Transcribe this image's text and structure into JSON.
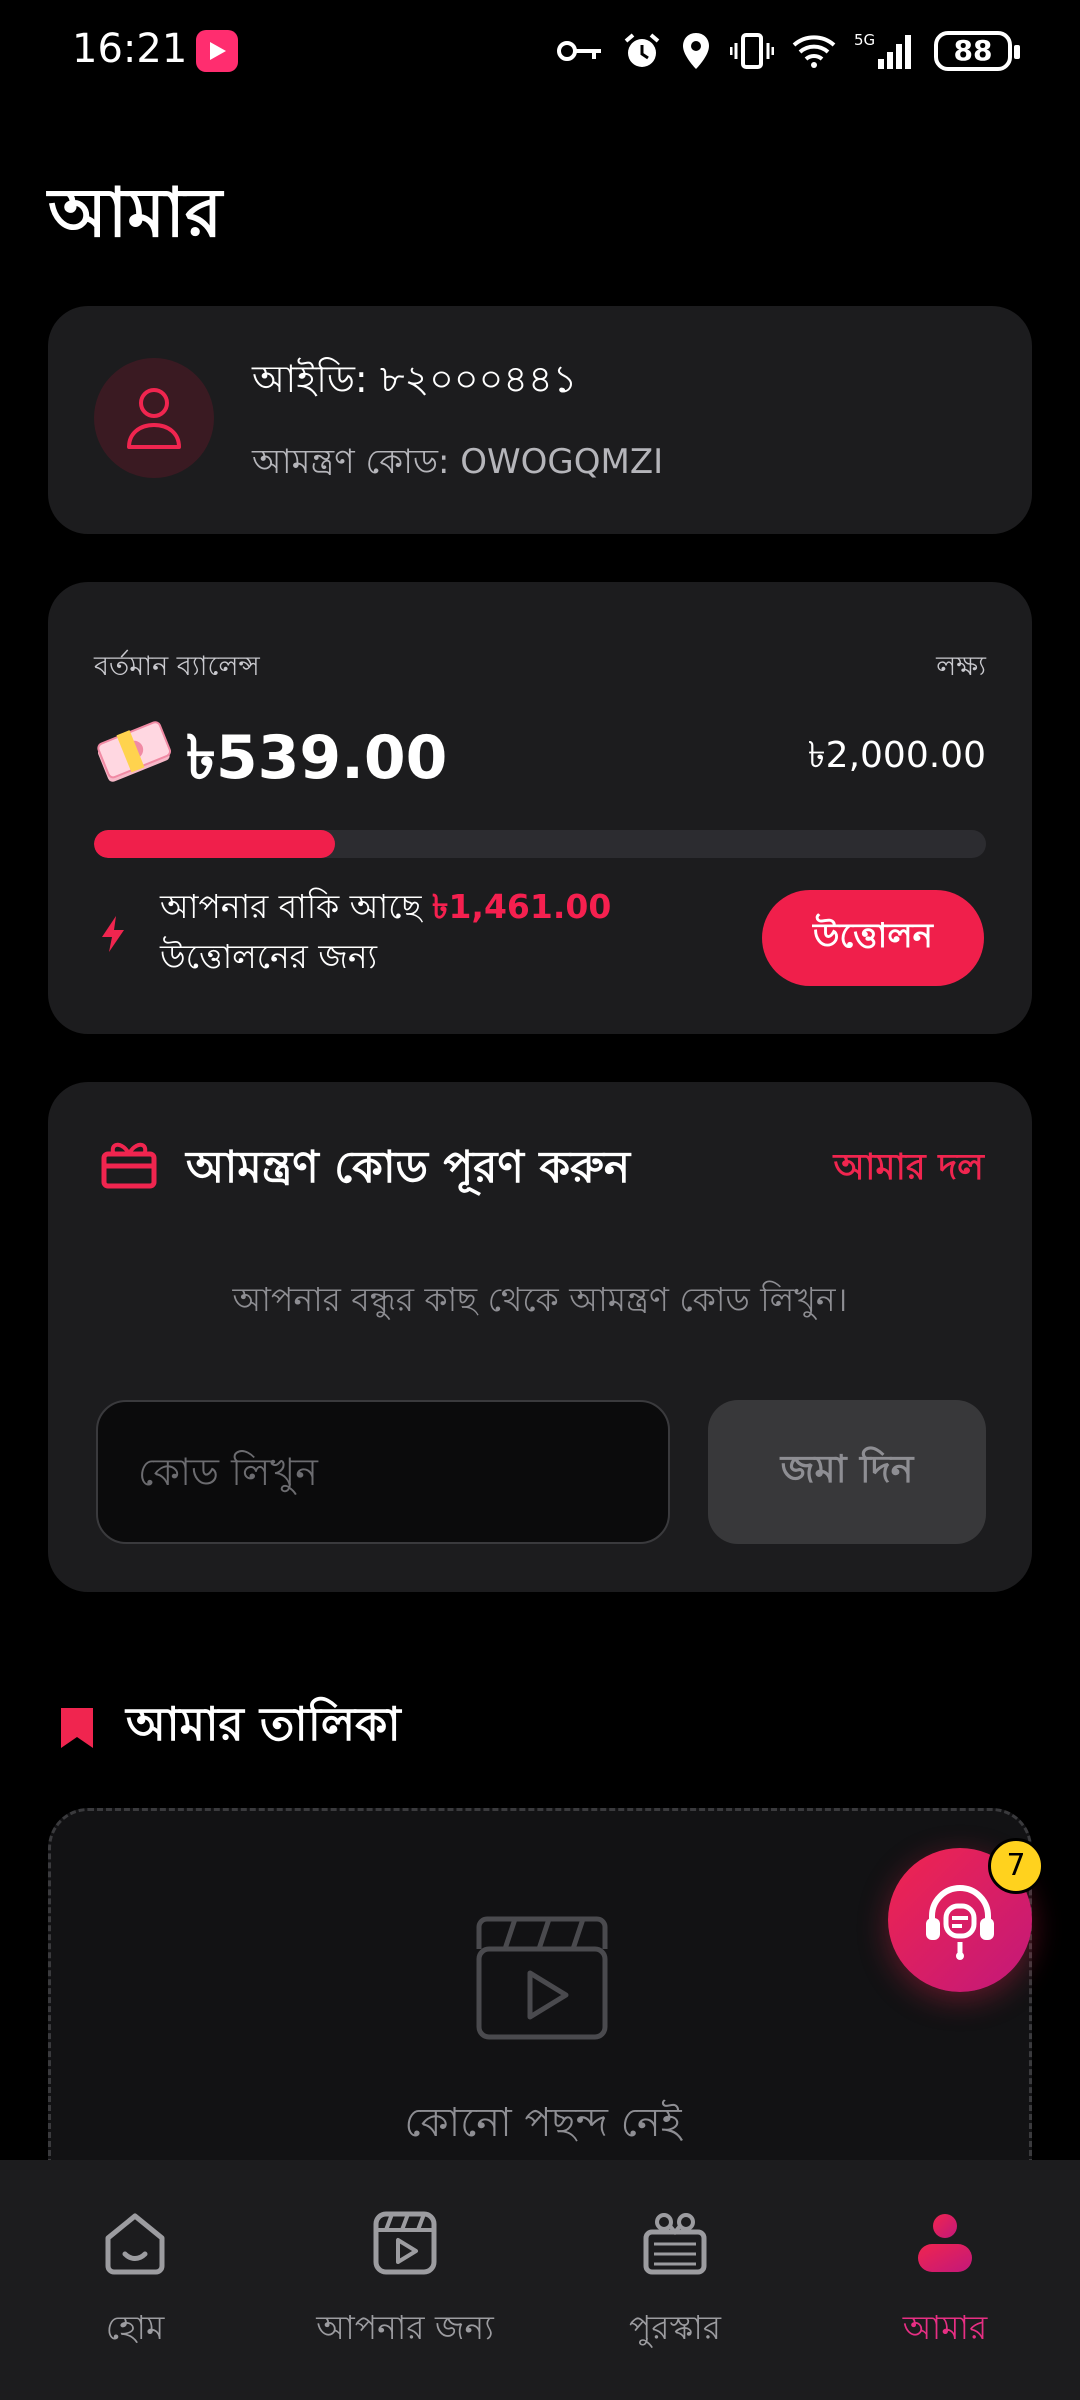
{
  "status_bar": {
    "time": "16:21",
    "network": "5G",
    "battery": "88",
    "icons": [
      "key-icon",
      "alarm-icon",
      "location-icon",
      "vibrate-icon",
      "wifi-icon",
      "signal-icon"
    ]
  },
  "page": {
    "title": "আমার"
  },
  "profile": {
    "id_text": "আইডি: ৮২০০০৪৪১",
    "invite_code_text": "আমন্ত্রণ কোড: OWOGQMZI"
  },
  "balance": {
    "label": "বর্তমান ব্যালেন্স",
    "amount": "৳539.00",
    "target_label": "লক্ষ্য",
    "target_amount": "৳2,000.00",
    "progress_fraction": 0.27,
    "remaining_prefix": "আপনার বাকি আছে",
    "remaining_amount": "৳1,461.00",
    "remaining_suffix": "উত্তোলনের জন্য",
    "withdraw_label": "উত্তোলন"
  },
  "invite": {
    "title": "আমন্ত্রণ কোড পূরণ করুন",
    "team_link": "আমার দল",
    "hint": "আপনার বন্ধুর কাছ থেকে আমন্ত্রণ কোড লিখুন।",
    "placeholder": "কোড লিখুন",
    "submit_label": "জমা দিন"
  },
  "my_list": {
    "title": "আমার তালিকা",
    "empty_text": "কোনো পছন্দ নেই"
  },
  "support": {
    "badge_count": "7"
  },
  "nav": {
    "items": [
      {
        "label": "হোম",
        "icon": "home-icon"
      },
      {
        "label": "আপনার জন্য",
        "icon": "clapperboard-icon"
      },
      {
        "label": "পুরস্কার",
        "icon": "reward-icon"
      },
      {
        "label": "আমার",
        "icon": "profile-icon"
      }
    ],
    "active": 3
  },
  "colors": {
    "accent": "#f01f4b",
    "accent_pink": "#e72f84",
    "card": "#1c1c1e",
    "background": "#000000"
  }
}
